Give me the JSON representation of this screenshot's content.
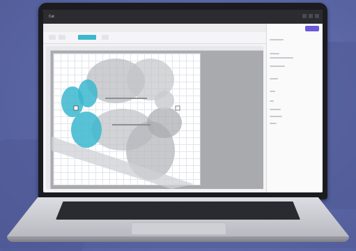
{
  "scene": {
    "description_free": true,
    "background_color": "#5a66a4"
  },
  "app": {
    "titlebar_left": "Cut",
    "titlebar_center": "",
    "project_label": "",
    "right_panel_title": "",
    "right_panel_button": ""
  },
  "colors": {
    "accent_cyan": "#3bb7cf",
    "accent_purple": "#6b59d8",
    "mat_grid": "#e3e5ea"
  },
  "icons": [
    "close-icon",
    "minimize-icon",
    "maximize-icon"
  ]
}
